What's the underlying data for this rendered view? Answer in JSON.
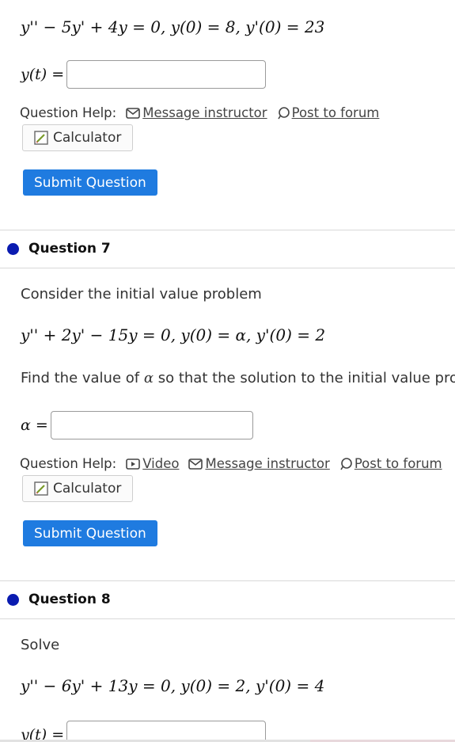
{
  "q6": {
    "equation": "y'' − 5y' + 4y = 0,  y(0) = 8,  y'(0) = 23",
    "answer_label": "y(t)",
    "answer_eq": "=",
    "answer_value": ""
  },
  "help": {
    "label": "Question Help:",
    "video": "Video",
    "message": "Message instructor",
    "forum": "Post to forum",
    "calculator": "Calculator",
    "submit": "Submit Question"
  },
  "q7": {
    "title": "Question 7",
    "intro": "Consider the initial value problem",
    "equation": "y'' + 2y' − 15y = 0,  y(0) = α,  y'(0) = 2",
    "find_text_pre": "Find the value of ",
    "find_symbol": "α",
    "find_text_post": " so that the solution to the initial value probl",
    "answer_label": "α",
    "answer_eq": "=",
    "answer_value": ""
  },
  "q8": {
    "title": "Question 8",
    "intro": "Solve",
    "equation": "y'' − 6y' + 13y = 0,  y(0) = 2,  y'(0) = 4",
    "answer_label": "y(t)",
    "answer_eq": "="
  },
  "colors": {
    "submit_bg": "#1f7be0",
    "question_dot": "#0a1bb0"
  },
  "icons": {
    "message": "envelope-icon",
    "forum": "speech-bubble-icon",
    "video": "play-icon",
    "calculator": "calculator-pencil-icon"
  }
}
